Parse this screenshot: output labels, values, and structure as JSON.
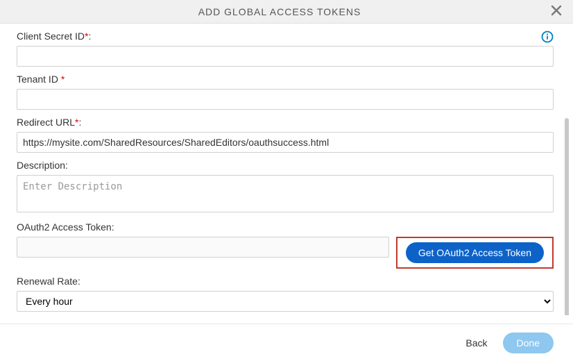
{
  "header": {
    "title": "ADD GLOBAL ACCESS TOKENS"
  },
  "fields": {
    "client_secret": {
      "label": "Client Secret ID",
      "value": ""
    },
    "tenant_id": {
      "label": "Tenant ID ",
      "value": ""
    },
    "redirect_url": {
      "label": "Redirect URL",
      "value": "https://mysite.com/SharedResources/SharedEditors/oauthsuccess.html"
    },
    "description": {
      "label": "Description:",
      "placeholder": "Enter Description",
      "value": ""
    },
    "oauth_token": {
      "label": "OAuth2 Access Token:",
      "value": ""
    },
    "renewal_rate": {
      "label": "Renewal Rate:",
      "selected": "Every hour"
    }
  },
  "buttons": {
    "get_token": "Get OAuth2 Access Token",
    "back": "Back",
    "done": "Done"
  }
}
